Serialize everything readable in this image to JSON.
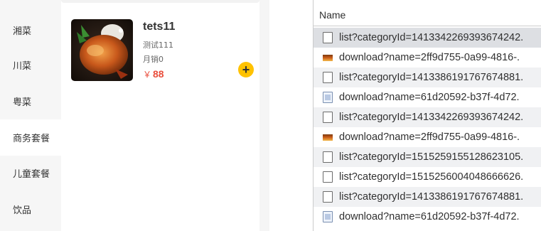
{
  "app": {
    "categories": [
      {
        "label": "湘菜",
        "active": false
      },
      {
        "label": "川菜",
        "active": false
      },
      {
        "label": "粤菜",
        "active": false
      },
      {
        "label": "商务套餐",
        "active": true
      },
      {
        "label": "儿童套餐",
        "active": false
      },
      {
        "label": "饮品",
        "active": false
      }
    ],
    "dish": {
      "name": "tets11",
      "description": "测试111",
      "sales": "月销0",
      "price_symbol": "￥",
      "price": "88",
      "add_icon": "plus-icon",
      "add_color": "#ffc200",
      "price_color": "#e94e3c"
    }
  },
  "network": {
    "column_header": "Name",
    "rows": [
      {
        "name": "list?categoryId=1413342269393674242.",
        "type": "doc"
      },
      {
        "name": "download?name=2ff9d755-0a99-4816-.",
        "type": "img"
      },
      {
        "name": "list?categoryId=1413386191767674881.",
        "type": "doc"
      },
      {
        "name": "download?name=61d20592-b37f-4d72.",
        "type": "file"
      },
      {
        "name": "list?categoryId=1413342269393674242.",
        "type": "doc"
      },
      {
        "name": "download?name=2ff9d755-0a99-4816-.",
        "type": "img"
      },
      {
        "name": "list?categoryId=1515259155128623105.",
        "type": "doc"
      },
      {
        "name": "list?categoryId=1515256004048666626.",
        "type": "doc"
      },
      {
        "name": "list?categoryId=1413386191767674881.",
        "type": "doc"
      },
      {
        "name": "download?name=61d20592-b37f-4d72.",
        "type": "file"
      }
    ]
  }
}
